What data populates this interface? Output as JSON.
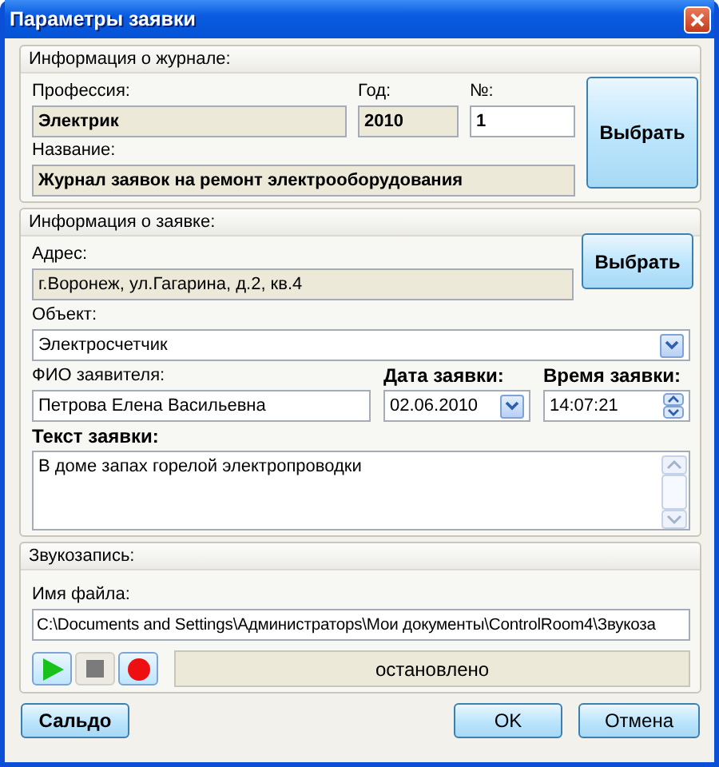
{
  "window": {
    "title": "Параметры заявки"
  },
  "journal": {
    "title": "Информация о журнале:",
    "fields": [
      {
        "label": "Профессия:",
        "value": "Электрик",
        "readonly": true
      },
      {
        "label": "Год:",
        "value": "2010",
        "readonly": true
      },
      {
        "label": "№:",
        "value": "1",
        "readonly": false
      },
      {
        "label": "Название:",
        "value": "Журнал заявок на ремонт электрооборудования",
        "readonly": true
      }
    ],
    "button": "Выбрать"
  },
  "request": {
    "title": "Информация о заявке:",
    "fields": [
      {
        "label": "Адрес:",
        "value": "г.Воронеж, ул.Гагарина, д.2, кв.4",
        "kind": "text",
        "readonly": true
      },
      {
        "label": "Объект:",
        "value": "Электросчетчик",
        "kind": "combo",
        "readonly": false
      },
      {
        "label": "ФИО заявителя:",
        "value": "Петрова Елена Васильевна",
        "kind": "text",
        "readonly": false
      },
      {
        "label": "Дата заявки:",
        "value": "02.06.2010",
        "kind": "date",
        "readonly": false
      },
      {
        "label": "Время заявки:",
        "value": "14:07:21",
        "kind": "time",
        "readonly": false
      },
      {
        "label": "Текст заявки:",
        "value": "В доме запах горелой электропроводки",
        "kind": "memo",
        "readonly": false
      }
    ],
    "button": "Выбрать"
  },
  "recording": {
    "title": "Звукозапись:",
    "file": {
      "label": "Имя файла:",
      "value": "C:\\Documents and Settings\\Администраторs\\Мои документы\\ControlRoom4\\Звукоза"
    },
    "controls": [
      {
        "kind": "play",
        "disabled": false
      },
      {
        "kind": "stop",
        "disabled": true
      },
      {
        "kind": "record",
        "disabled": false
      }
    ],
    "status": "остановлено"
  },
  "buttons": [
    {
      "label": "Сальдо"
    },
    {
      "label": "OK"
    },
    {
      "label": "Отмена"
    }
  ]
}
